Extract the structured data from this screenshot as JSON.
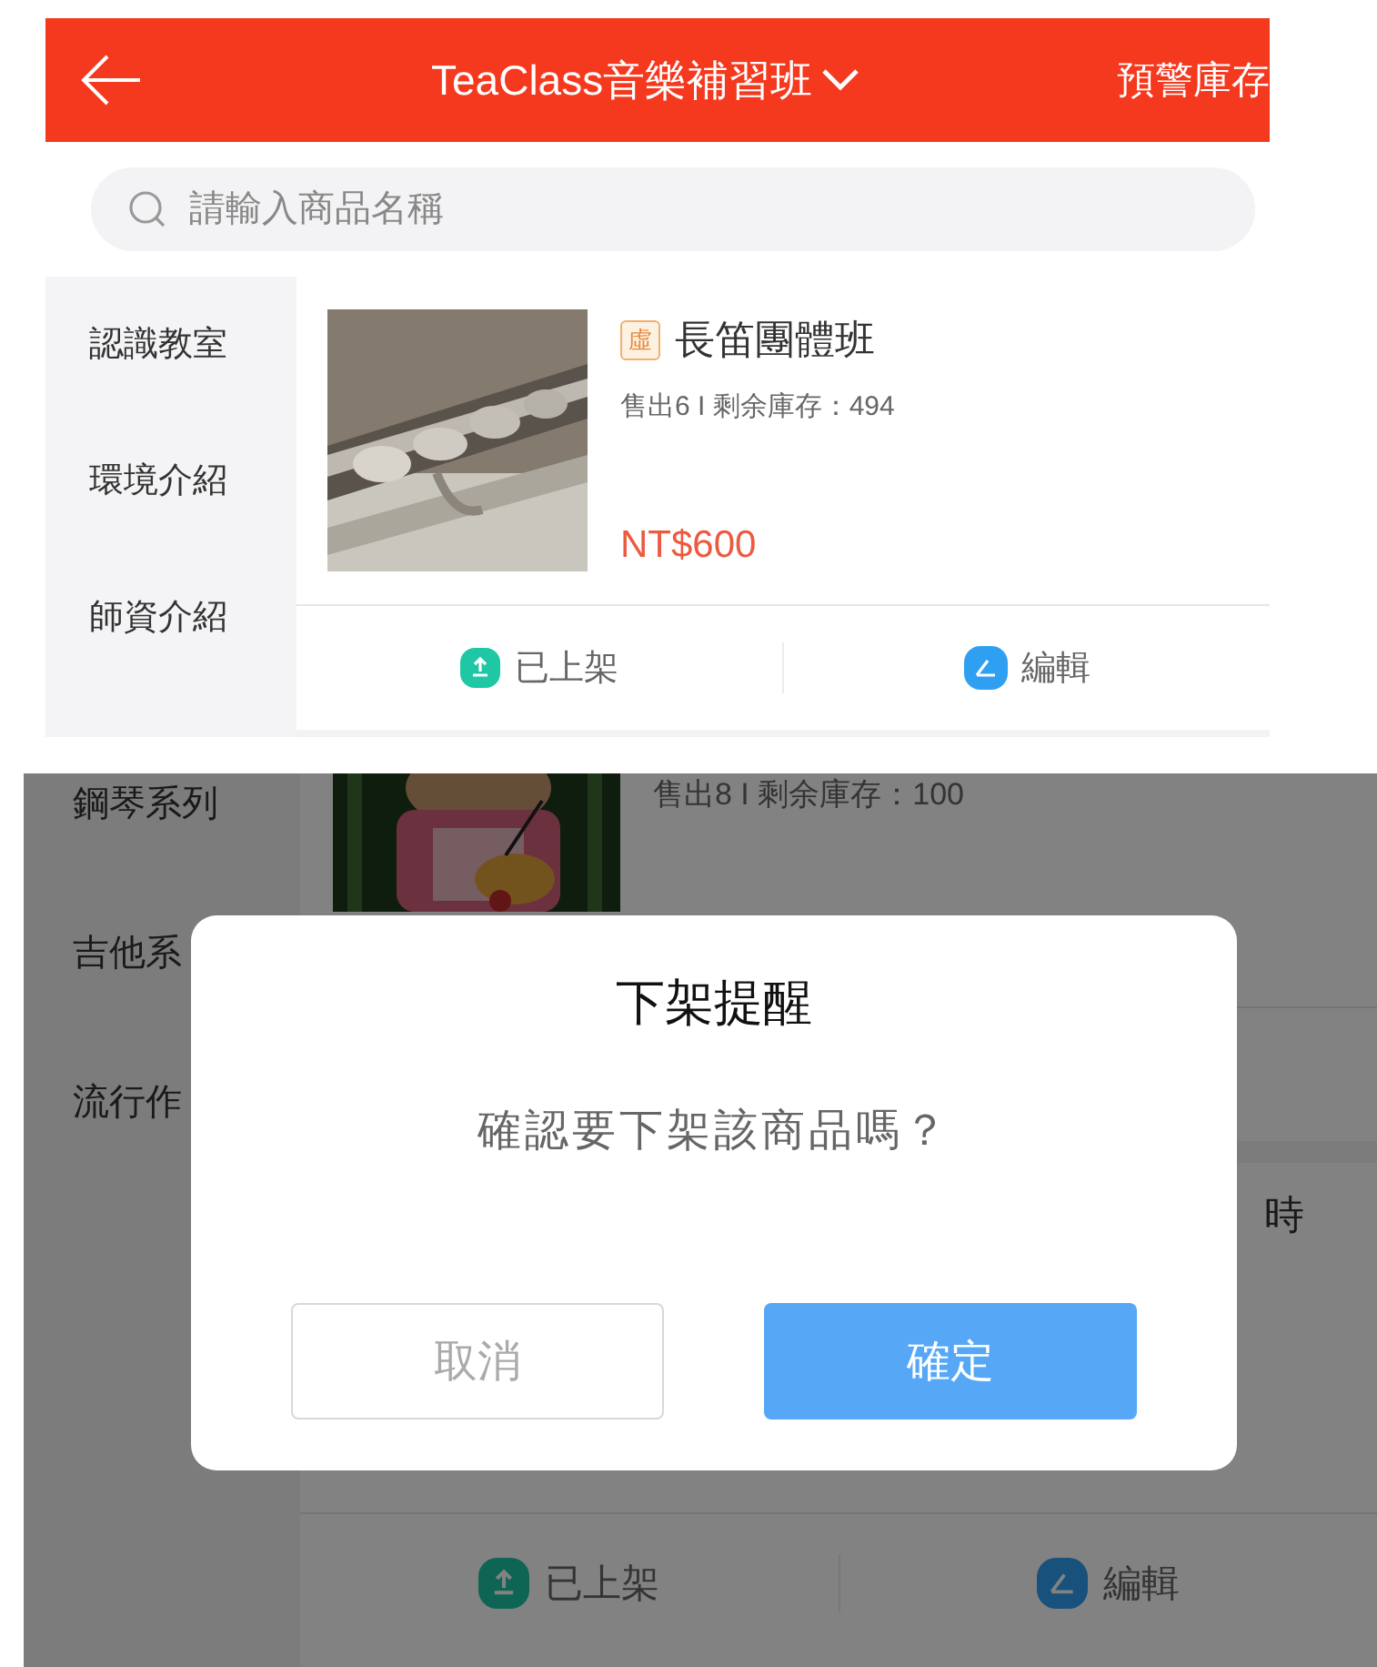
{
  "top_screen": {
    "header": {
      "title": "TeaClass音樂補習班",
      "action": "預警庫存"
    },
    "search": {
      "placeholder": "請輸入商品名稱"
    },
    "sidebar": {
      "items": [
        {
          "label": "認識教室",
          "selected": false
        },
        {
          "label": "環境介紹",
          "selected": false
        },
        {
          "label": "師資介紹",
          "selected": false
        }
      ]
    },
    "product": {
      "badge": "虛",
      "title": "長笛團體班",
      "stats": "售出6 I 剩余庫存：494",
      "price": "NT$600",
      "actions": [
        {
          "kind": "listed",
          "label": "已上架"
        },
        {
          "kind": "edit",
          "label": "編輯"
        }
      ]
    }
  },
  "bottom_screen": {
    "sidebar": {
      "items": [
        {
          "label": "鋼琴系列",
          "selected": false
        },
        {
          "label": "吉他系",
          "selected": false
        },
        {
          "label": "流行作",
          "selected": false
        }
      ]
    },
    "first_product": {
      "stats": "售出8 I 剩余庫存：100"
    },
    "second_product": {
      "title": "時",
      "actions": [
        {
          "kind": "listed",
          "label": "已上架"
        },
        {
          "kind": "edit",
          "label": "編輯"
        }
      ]
    },
    "dialog": {
      "title": "下架提醒",
      "message": "確認要下架該商品嗎？",
      "buttons": [
        {
          "kind": "cancel",
          "label": "取消"
        },
        {
          "kind": "confirm",
          "label": "確定"
        }
      ]
    }
  }
}
